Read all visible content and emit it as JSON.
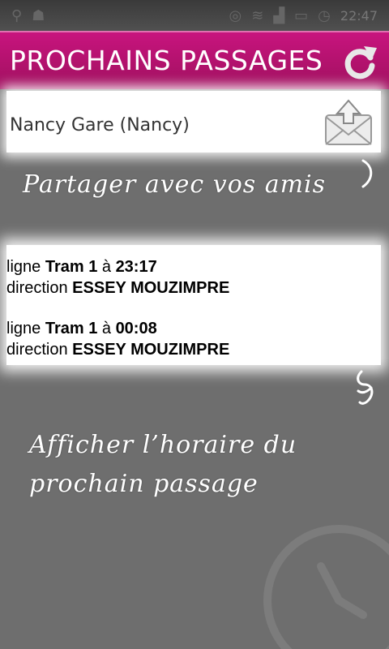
{
  "status_bar": {
    "time": "22:47",
    "icons": [
      "usb-icon",
      "android-icon",
      "location-icon",
      "wifi-icon",
      "signal-icon",
      "battery-icon",
      "alarm-icon"
    ]
  },
  "header": {
    "title": "PROCHAINS PASSAGES",
    "refresh_icon": "refresh-icon"
  },
  "search": {
    "station": "Nancy Gare (Nancy)",
    "share_icon": "mail-share-icon"
  },
  "hints": {
    "share": "Partager avec vos amis",
    "schedule_line1": "Afficher l’horaire du",
    "schedule_line2": "prochain passage"
  },
  "passages": [
    {
      "ligne_label": "ligne",
      "line": "Tram 1",
      "a_label": "à",
      "time": "23:17",
      "direction_label": "direction",
      "direction": "ESSEY MOUZIMPRE"
    },
    {
      "ligne_label": "ligne",
      "line": "Tram 1",
      "a_label": "à",
      "time": "00:08",
      "direction_label": "direction",
      "direction": "ESSEY MOUZIMPRE"
    }
  ],
  "colors": {
    "accent": "#b8126f",
    "overlay": "#6e6e6e"
  }
}
